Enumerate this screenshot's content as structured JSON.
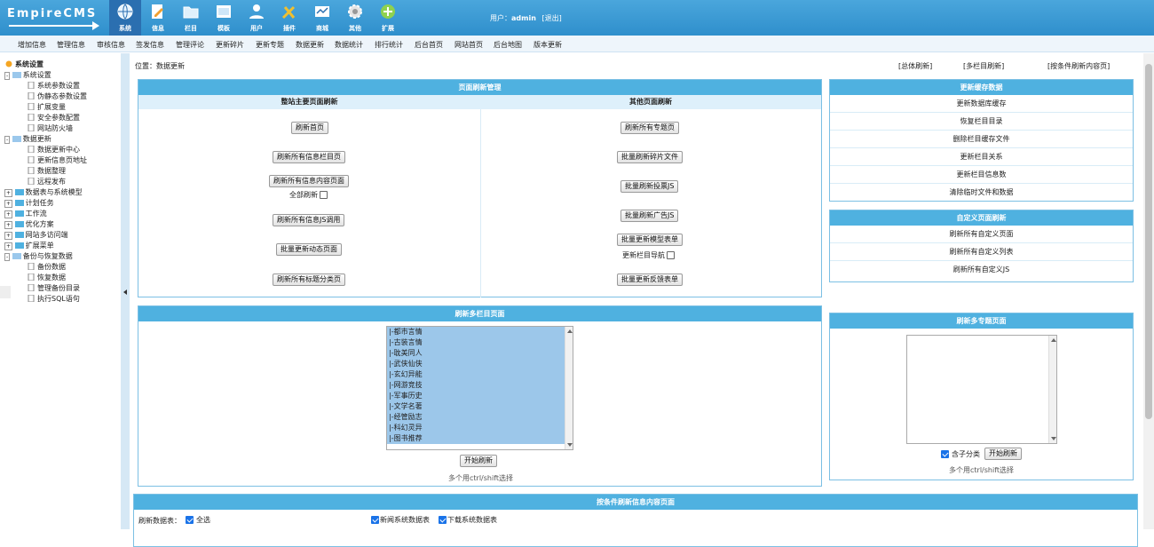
{
  "logo": "EmpireCMS",
  "topnav": [
    {
      "label": "系统",
      "icon": "globe-icon",
      "active": true
    },
    {
      "label": "信息",
      "icon": "edit-icon",
      "active": false
    },
    {
      "label": "栏目",
      "icon": "folder-icon",
      "active": false
    },
    {
      "label": "模板",
      "icon": "template-icon",
      "active": false
    },
    {
      "label": "用户",
      "icon": "user-icon",
      "active": false
    },
    {
      "label": "插件",
      "icon": "tools-icon",
      "active": false
    },
    {
      "label": "商城",
      "icon": "shop-icon",
      "active": false
    },
    {
      "label": "其他",
      "icon": "gear-icon",
      "active": false
    },
    {
      "label": "扩展",
      "icon": "plus-icon",
      "active": false
    }
  ],
  "user": {
    "prefix": "用户：",
    "name": "admin",
    "logout": "[退出]"
  },
  "subnav": [
    "增加信息",
    "管理信息",
    "审核信息",
    "签发信息",
    "管理评论",
    "更新碎片",
    "更新专题",
    "数据更新",
    "数据统计",
    "排行统计",
    "后台首页",
    "网站首页",
    "后台地图",
    "版本更新"
  ],
  "sidebar": {
    "root": "系统设置",
    "items": [
      {
        "label": "系统设置",
        "type": "folder",
        "open": true,
        "level": 0
      },
      {
        "label": "系统参数设置",
        "type": "page",
        "level": 1
      },
      {
        "label": "伪静态参数设置",
        "type": "page",
        "level": 1
      },
      {
        "label": "扩展变量",
        "type": "page",
        "level": 1
      },
      {
        "label": "安全参数配置",
        "type": "page",
        "level": 1
      },
      {
        "label": "网站防火墙",
        "type": "page",
        "level": 1
      },
      {
        "label": "数据更新",
        "type": "folder",
        "open": true,
        "level": 0
      },
      {
        "label": "数据更新中心",
        "type": "page",
        "level": 1
      },
      {
        "label": "更新信息页地址",
        "type": "page",
        "level": 1
      },
      {
        "label": "数据整理",
        "type": "page",
        "level": 1
      },
      {
        "label": "远程发布",
        "type": "page",
        "level": 1
      },
      {
        "label": "数据表与系统模型",
        "type": "folder",
        "open": false,
        "level": 0
      },
      {
        "label": "计划任务",
        "type": "folder",
        "open": false,
        "level": 0
      },
      {
        "label": "工作流",
        "type": "folder",
        "open": false,
        "level": 0
      },
      {
        "label": "优化方案",
        "type": "folder",
        "open": false,
        "level": 0
      },
      {
        "label": "网站多访问端",
        "type": "folder",
        "open": false,
        "level": 0
      },
      {
        "label": "扩展菜单",
        "type": "folder",
        "open": false,
        "level": 0
      },
      {
        "label": "备份与恢复数据",
        "type": "folder",
        "open": true,
        "level": 0
      },
      {
        "label": "备份数据",
        "type": "page",
        "level": 1
      },
      {
        "label": "恢复数据",
        "type": "page",
        "level": 1
      },
      {
        "label": "管理备份目录",
        "type": "page",
        "level": 1
      },
      {
        "label": "执行SQL语句",
        "type": "page",
        "level": 1
      }
    ]
  },
  "main": {
    "crumb": "位置：数据更新",
    "toplinks": [
      "[总体刷新]",
      "[多栏目刷新]",
      "[按条件刷新内容页]"
    ],
    "page_refresh": {
      "title": "页面刷新管理",
      "left_header": "整站主要页面刷新",
      "right_header": "其他页面刷新",
      "left_buttons": [
        "刷新首页",
        "刷新所有信息栏目页",
        "刷新所有信息内容页面",
        "刷新所有信息JS调用",
        "批量更新动态页面",
        "刷新所有标题分类页"
      ],
      "all_refresh": "全部刷新",
      "right_buttons": [
        "刷新所有专题页",
        "批量刷新碎片文件",
        "批量刷新投票JS",
        "批量刷新广告JS",
        "批量更新模型表单",
        "批量更新反馈表单"
      ],
      "update_nav": "更新栏目导航"
    },
    "cache": {
      "title": "更新缓存数据",
      "items": [
        "更新数据库缓存",
        "恢复栏目目录",
        "删除栏目缓存文件",
        "更新栏目关系",
        "更新栏目信息数",
        "清除临时文件和数据"
      ]
    },
    "custom": {
      "title": "自定义页面刷新",
      "items": [
        "刷新所有自定义页面",
        "刷新所有自定义列表",
        "刷新所有自定义JS"
      ]
    },
    "multi_class": {
      "title": "刷新多栏目页面",
      "options": [
        "|-都市言情",
        "|-古装言情",
        "|-耽美同人",
        "|-武侠仙侠",
        "|-玄幻异能",
        "|-网游竞技",
        "|-军事历史",
        "|-文学名著",
        "|-经管励志",
        "|-科幻灵异",
        "|-图书推荐"
      ],
      "button": "开始刷新",
      "hint": "多个用ctrl/shift选择"
    },
    "multi_zt": {
      "title": "刷新多专题页面",
      "include_sub": "含子分类",
      "button": "开始刷新",
      "hint": "多个用ctrl/shift选择"
    },
    "cond": {
      "title": "按条件刷新信息内容页面",
      "table_label": "刷新数据表：",
      "select_all": "全选",
      "tables": [
        "新闻系统数据表",
        "下载系统数据表"
      ]
    }
  }
}
